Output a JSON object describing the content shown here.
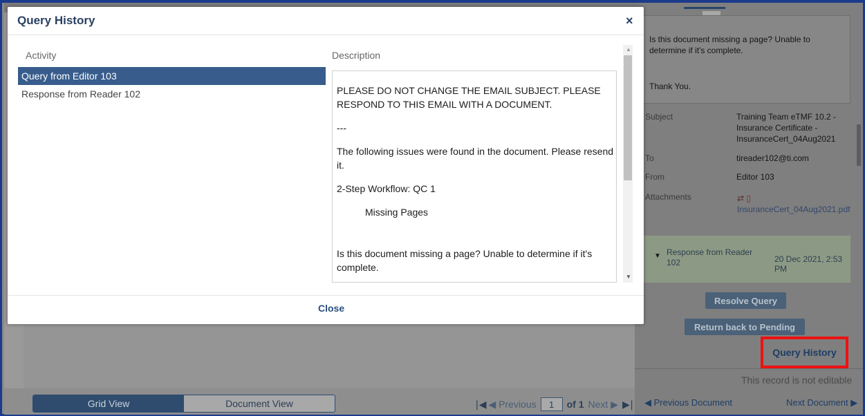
{
  "modal": {
    "title": "Query History",
    "close_icon": "×",
    "activity_header": "Activity",
    "description_header": "Description",
    "activities": [
      {
        "label": "Query from Editor 103",
        "selected": true
      },
      {
        "label": "Response from Reader 102",
        "selected": false
      }
    ],
    "description": {
      "p1": "PLEASE DO NOT CHANGE THE EMAIL SUBJECT. PLEASE RESPOND TO THIS EMAIL WITH A DOCUMENT.",
      "p2": "---",
      "p3": "The following issues were found in the document. Please resend it.",
      "p4": "2-Step Workflow: QC 1",
      "p5": "Missing Pages",
      "p6": "Is this document missing a page? Unable to determine if it's complete."
    },
    "footer_close": "Close"
  },
  "right_panel": {
    "message_line1": "Is this document missing a page? Unable to determine if it's complete.",
    "message_thanks": "Thank You.",
    "subject_label": "Subject",
    "subject_value": "Training Team eTMF 10.2 - Insurance Certificate - InsuranceCert_04Aug2021",
    "to_label": "To",
    "to_value": "tireader102@ti.com",
    "from_label": "From",
    "from_value": "Editor 103",
    "attachments_label": "Attachments",
    "attachment_file": "InsuranceCert_04Aug2021.pdf",
    "response_label": "Response from Reader 102",
    "response_date": "20 Dec 2021, 2:53 PM",
    "resolve_button": "Resolve Query",
    "return_button": "Return back to Pending",
    "query_history_link": "Query History",
    "not_editable": "This record is not editable",
    "prev_document": "◀ Previous Document",
    "next_document": "Next Document ▶"
  },
  "bottom_bar": {
    "grid_view": "Grid View",
    "document_view": "Document View",
    "first_icon": "◀",
    "previous": "◀ Previous",
    "page_value": "1",
    "of_total": "of 1",
    "next": "Next ▶",
    "last_icon": "▶"
  },
  "colors": {
    "accent": "#385d8d",
    "highlight_border": "#ee1111",
    "frame_border": "#1b3a8c"
  }
}
